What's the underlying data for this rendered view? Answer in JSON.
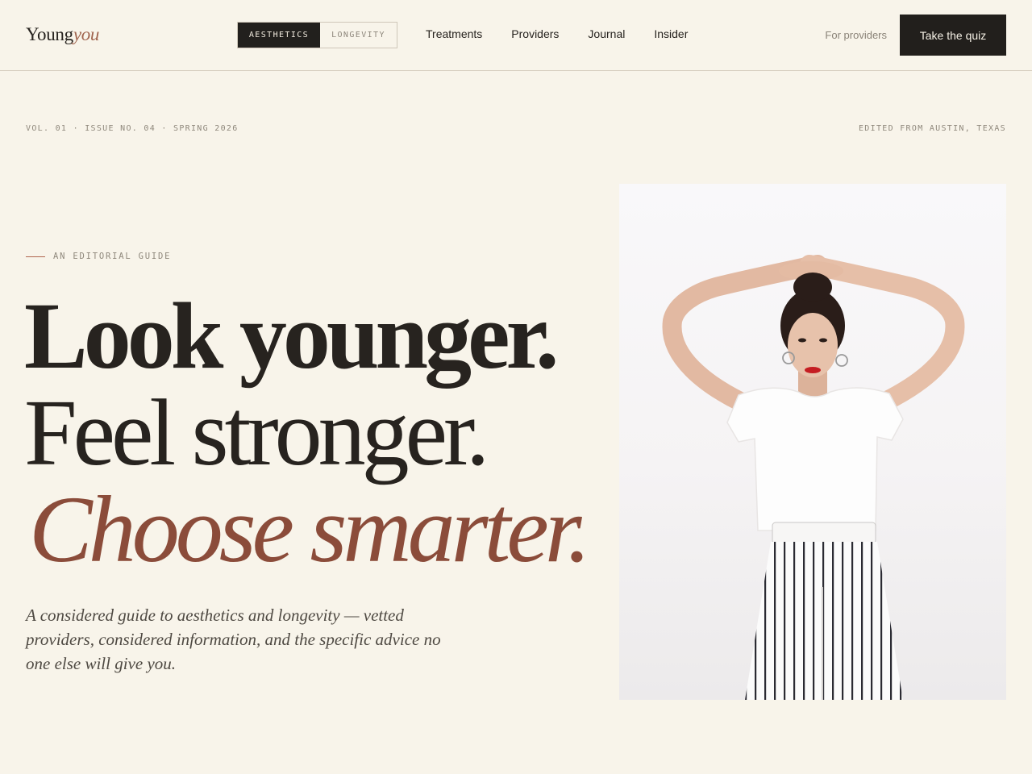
{
  "header": {
    "logo": {
      "main": "Young",
      "accent": "you"
    },
    "segments": [
      {
        "label": "AESTHETICS",
        "active": true
      },
      {
        "label": "LONGEVITY",
        "active": false
      }
    ],
    "nav": [
      "Treatments",
      "Providers",
      "Journal",
      "Insider"
    ],
    "for_providers": "For providers",
    "cta": "Take the quiz"
  },
  "meta": {
    "issue": "VOL. 01 · ISSUE NO. 04 · SPRING 2026",
    "location": "EDITED FROM AUSTIN, TEXAS"
  },
  "hero": {
    "eyebrow": "AN EDITORIAL GUIDE",
    "headline": [
      "Look younger.",
      "Feel stronger.",
      "Choose smarter."
    ],
    "subheading": "A considered guide to aesthetics and longevity — vetted providers, considered information, and the specific advice no one else will give you."
  },
  "colors": {
    "background": "#f8f4ea",
    "ink": "#27231f",
    "accent": "#8b4c3a",
    "button": "#221f1c"
  }
}
